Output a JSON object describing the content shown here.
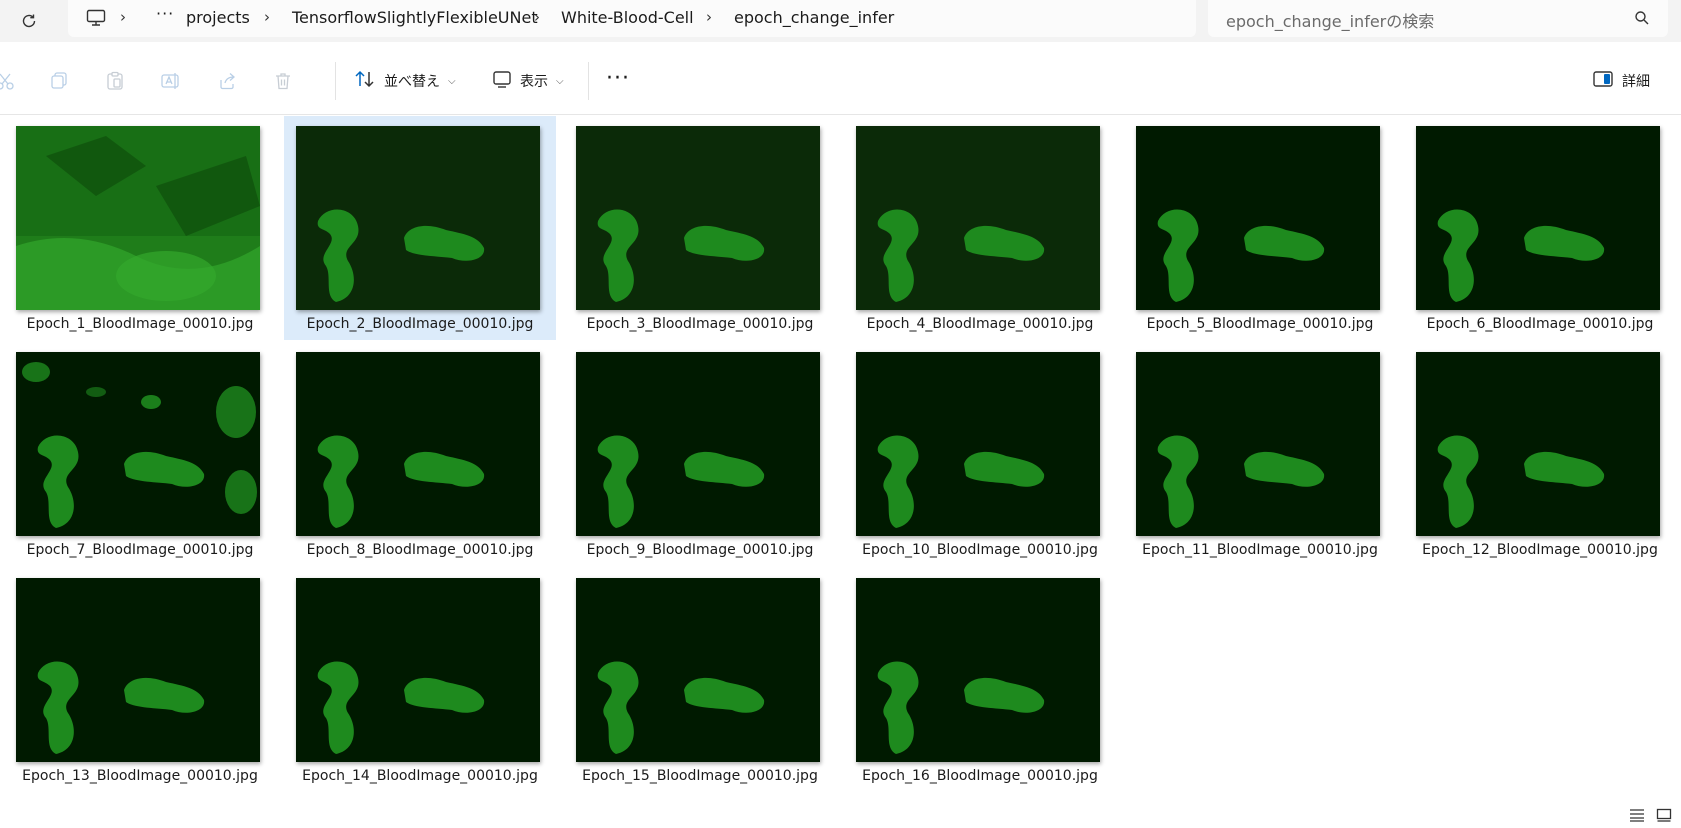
{
  "address_bar": {
    "breadcrumbs": [
      "projects",
      "TensorflowSlightlyFlexibleUNet",
      "White-Blood-Cell",
      "epoch_change_infer"
    ],
    "more": "···",
    "search_placeholder": "epoch_change_inferの検索"
  },
  "command_bar": {
    "sort_label": "並べ替え",
    "view_label": "表示",
    "more": "···",
    "details_label": "詳細"
  },
  "files": [
    {
      "name": "Epoch_1_BloodImage_00010.jpg",
      "selected": false
    },
    {
      "name": "Epoch_2_BloodImage_00010.jpg",
      "selected": true
    },
    {
      "name": "Epoch_3_BloodImage_00010.jpg",
      "selected": false
    },
    {
      "name": "Epoch_4_BloodImage_00010.jpg",
      "selected": false
    },
    {
      "name": "Epoch_5_BloodImage_00010.jpg",
      "selected": false
    },
    {
      "name": "Epoch_6_BloodImage_00010.jpg",
      "selected": false
    },
    {
      "name": "Epoch_7_BloodImage_00010.jpg",
      "selected": false
    },
    {
      "name": "Epoch_8_BloodImage_00010.jpg",
      "selected": false
    },
    {
      "name": "Epoch_9_BloodImage_00010.jpg",
      "selected": false
    },
    {
      "name": "Epoch_10_BloodImage_00010.jpg",
      "selected": false
    },
    {
      "name": "Epoch_11_BloodImage_00010.jpg",
      "selected": false
    },
    {
      "name": "Epoch_12_BloodImage_00010.jpg",
      "selected": false
    },
    {
      "name": "Epoch_13_BloodImage_00010.jpg",
      "selected": false
    },
    {
      "name": "Epoch_14_BloodImage_00010.jpg",
      "selected": false
    },
    {
      "name": "Epoch_15_BloodImage_00010.jpg",
      "selected": false
    },
    {
      "name": "Epoch_16_BloodImage_00010.jpg",
      "selected": false
    }
  ],
  "icons": {
    "refresh": "refresh-icon",
    "pc": "computer-icon",
    "search": "search-icon",
    "cut": "cut-icon",
    "copy": "copy-icon",
    "paste": "paste-icon",
    "rename": "rename-icon",
    "share": "share-icon",
    "delete": "delete-icon",
    "sort": "sort-icon",
    "view": "view-icon",
    "details": "details-pane-icon",
    "list_view": "details-view-icon",
    "tile_view": "large-icons-view-icon"
  },
  "colors": {
    "selection": "#dcebfa",
    "accent": "#0067c0",
    "thumb_bg": "#001a00",
    "segment": "#1e8a1e"
  }
}
